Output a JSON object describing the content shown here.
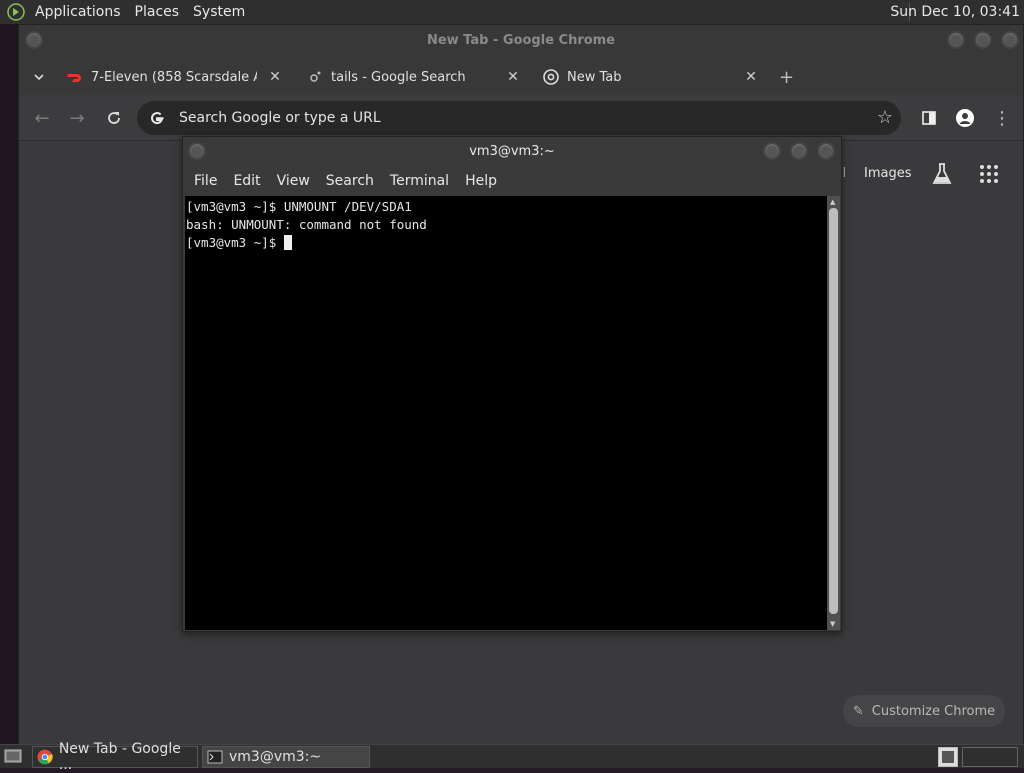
{
  "top_panel": {
    "menus": [
      "Applications",
      "Places",
      "System"
    ],
    "clock": "Sun Dec 10, 03:41"
  },
  "chrome": {
    "title": "New Tab - Google Chrome",
    "tabs": [
      {
        "label": "7-Eleven (858 Scarsdale Ave",
        "icon": "doordash-icon"
      },
      {
        "label": "tails - Google Search",
        "icon": "google-search-icon"
      },
      {
        "label": "New Tab",
        "icon": "chrome-icon"
      }
    ],
    "omnibox_text": "Search Google or type a URL",
    "ntp": {
      "mail_partial": "il",
      "images": "Images",
      "customize": "Customize Chrome"
    }
  },
  "terminal": {
    "title": "vm3@vm3:~",
    "menu": [
      "File",
      "Edit",
      "View",
      "Search",
      "Terminal",
      "Help"
    ],
    "lines": [
      "[vm3@vm3 ~]$ UNMOUNT /DEV/SDA1",
      "bash: UNMOUNT: command not found",
      "[vm3@vm3 ~]$ "
    ]
  },
  "taskbar": {
    "items": [
      {
        "label": "New Tab - Google ...",
        "icon": "chrome-icon"
      },
      {
        "label": "vm3@vm3:~",
        "icon": "terminal-icon"
      }
    ]
  }
}
